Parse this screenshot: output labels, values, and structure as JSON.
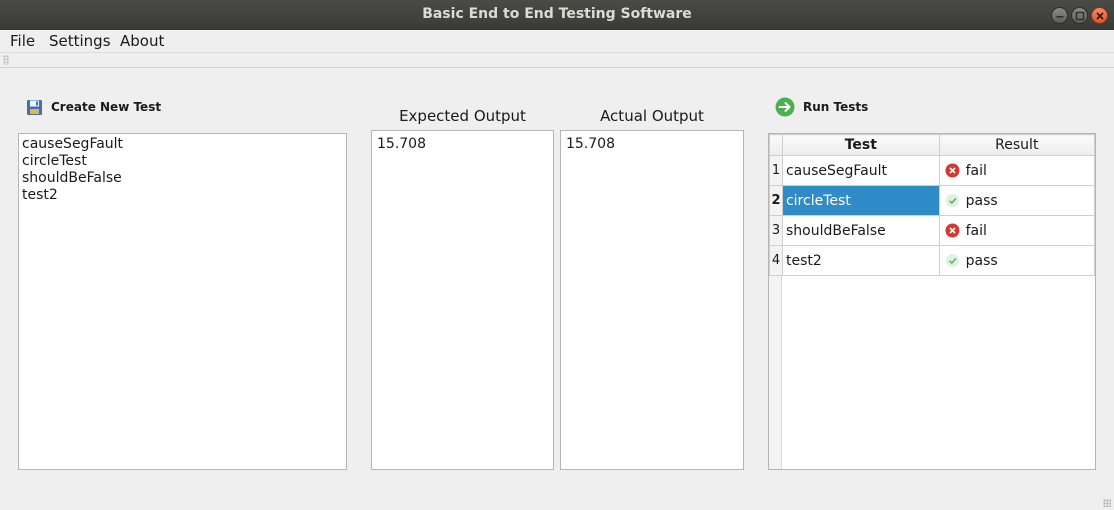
{
  "window": {
    "title": "Basic End to End Testing Software"
  },
  "menu": {
    "file": "File",
    "settings": "Settings",
    "about": "About"
  },
  "toolbar": {
    "create_label": "Create New Test",
    "create_icon": "save-disk-icon",
    "run_label": "Run Tests",
    "run_icon": "arrow-right-circle-icon"
  },
  "tests_list": [
    "causeSegFault",
    "circleTest",
    "shouldBeFalse",
    "test2"
  ],
  "expected": {
    "label": "Expected Output",
    "value": "15.708"
  },
  "actual": {
    "label": "Actual Output",
    "value": "15.708"
  },
  "results_table": {
    "headers": [
      "Test",
      "Result"
    ],
    "rows": [
      {
        "num": "1",
        "test": "causeSegFault",
        "result": "fail",
        "status_icon": "error-icon"
      },
      {
        "num": "2",
        "test": "circleTest",
        "result": "pass",
        "status_icon": "check-icon"
      },
      {
        "num": "3",
        "test": "shouldBeFalse",
        "result": "fail",
        "status_icon": "error-icon"
      },
      {
        "num": "4",
        "test": "test2",
        "result": "pass",
        "status_icon": "check-icon"
      }
    ],
    "selected_row": 1
  },
  "colors": {
    "selection": "#308cc6",
    "fail": "#d33a2f",
    "pass": "#7cc47c",
    "run_button": "#4caf50"
  }
}
